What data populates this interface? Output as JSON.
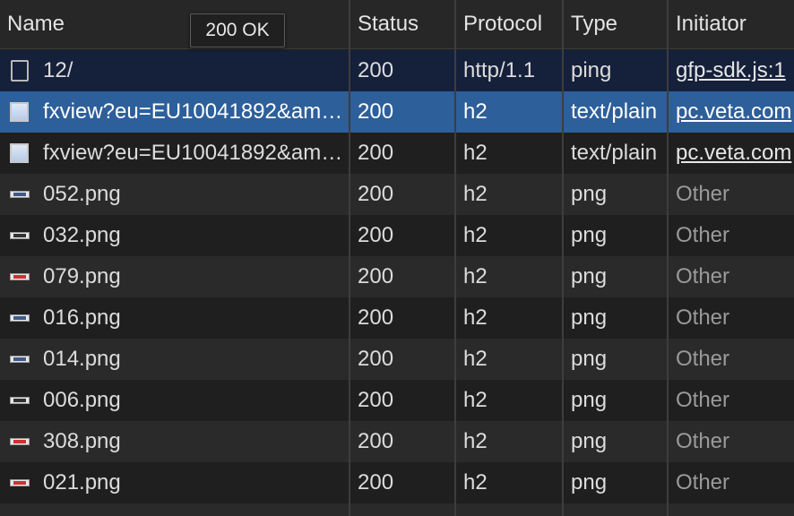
{
  "columns": {
    "name": "Name",
    "status": "Status",
    "protocol": "Protocol",
    "type": "Type",
    "initiator": "Initiator"
  },
  "tooltip": "200 OK",
  "rows": [
    {
      "name": "12/",
      "status": "200",
      "protocol": "http/1.1",
      "type": "ping",
      "initiator": "gfp-sdk.js:1",
      "icon": "document-icon",
      "initiator_link": true
    },
    {
      "name": "fxview?eu=EU10041892&amp;...",
      "status": "200",
      "protocol": "h2",
      "type": "text/plain",
      "initiator": "pc.veta.com",
      "icon": "image-icon",
      "initiator_link": true
    },
    {
      "name": "fxview?eu=EU10041892&amp;...",
      "status": "200",
      "protocol": "h2",
      "type": "text/plain",
      "initiator": "pc.veta.com",
      "icon": "image-icon",
      "initiator_link": true
    },
    {
      "name": "052.png",
      "status": "200",
      "protocol": "h2",
      "type": "png",
      "initiator": "Other",
      "icon": "png-thumbnail-icon",
      "initiator_link": false
    },
    {
      "name": "032.png",
      "status": "200",
      "protocol": "h2",
      "type": "png",
      "initiator": "Other",
      "icon": "png-thumbnail-icon",
      "initiator_link": false
    },
    {
      "name": "079.png",
      "status": "200",
      "protocol": "h2",
      "type": "png",
      "initiator": "Other",
      "icon": "png-thumbnail-icon",
      "initiator_link": false
    },
    {
      "name": "016.png",
      "status": "200",
      "protocol": "h2",
      "type": "png",
      "initiator": "Other",
      "icon": "png-thumbnail-icon",
      "initiator_link": false
    },
    {
      "name": "014.png",
      "status": "200",
      "protocol": "h2",
      "type": "png",
      "initiator": "Other",
      "icon": "png-thumbnail-icon",
      "initiator_link": false
    },
    {
      "name": "006.png",
      "status": "200",
      "protocol": "h2",
      "type": "png",
      "initiator": "Other",
      "icon": "png-thumbnail-icon",
      "initiator_link": false
    },
    {
      "name": "308.png",
      "status": "200",
      "protocol": "h2",
      "type": "png",
      "initiator": "Other",
      "icon": "png-thumbnail-icon",
      "initiator_link": false
    },
    {
      "name": "021.png",
      "status": "200",
      "protocol": "h2",
      "type": "png",
      "initiator": "Other",
      "icon": "png-thumbnail-icon",
      "initiator_link": false
    }
  ],
  "selected_row": 1,
  "colors": {
    "selected_row": "#2d5f9b",
    "first_row": "#15203a",
    "background": "#1f1f1f"
  }
}
